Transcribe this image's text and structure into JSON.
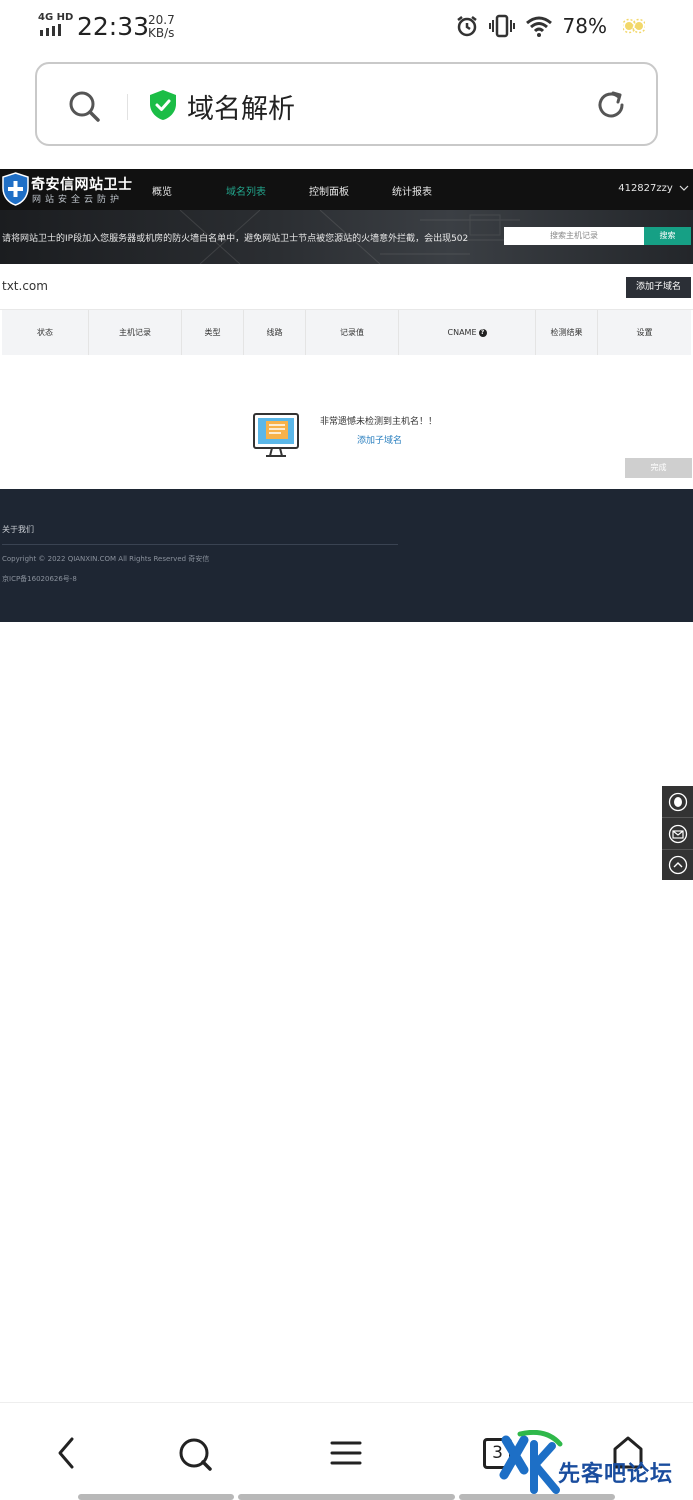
{
  "status_bar": {
    "network": "4G HD",
    "time": "22:33",
    "speed_value": "20.7",
    "speed_unit": "KB/s",
    "battery": "78%"
  },
  "url_bar": {
    "text": "域名解析",
    "icons": [
      "search-icon",
      "shield-check-icon",
      "reload-icon"
    ]
  },
  "site": {
    "logo_title": "奇安信网站卫士",
    "logo_subtitle": "网站安全云防护",
    "nav": [
      {
        "label": "概览",
        "active": false
      },
      {
        "label": "域名列表",
        "active": true
      },
      {
        "label": "控制面板",
        "active": false
      },
      {
        "label": "统计报表",
        "active": false
      }
    ],
    "user": "412827zzy",
    "banner_notice": "请将网站卫士的IP段加入您服务器或机房的防火墙白名单中，避免网站卫士节点被您源站的火墙意外拦截，会出现502",
    "search_placeholder": "搜索主机记录",
    "search_button": "搜索"
  },
  "content": {
    "domain": "txt.com",
    "add_subdomain_button": "添加子域名",
    "table_headers": [
      "状态",
      "主机记录",
      "类型",
      "线路",
      "记录值",
      "CNAME",
      "检测结果",
      "设置"
    ],
    "empty_message": "非常遗憾未检测到主机名！！",
    "empty_link": "添加子域名",
    "done_button": "完成"
  },
  "footer": {
    "about": "关于我们",
    "copyright": "Copyright © 2022 QIANXIN.COM All Rights Reserved 奇安信",
    "icp": "京ICP备16020626号-8"
  },
  "bottom_bar": {
    "tab_count": "3"
  },
  "watermark": {
    "text": "先客吧论坛"
  },
  "colors": {
    "accent_green": "#16a085",
    "header_bg": "#111111",
    "footer_bg": "#1e2633",
    "link_blue": "#2a7fbf"
  }
}
